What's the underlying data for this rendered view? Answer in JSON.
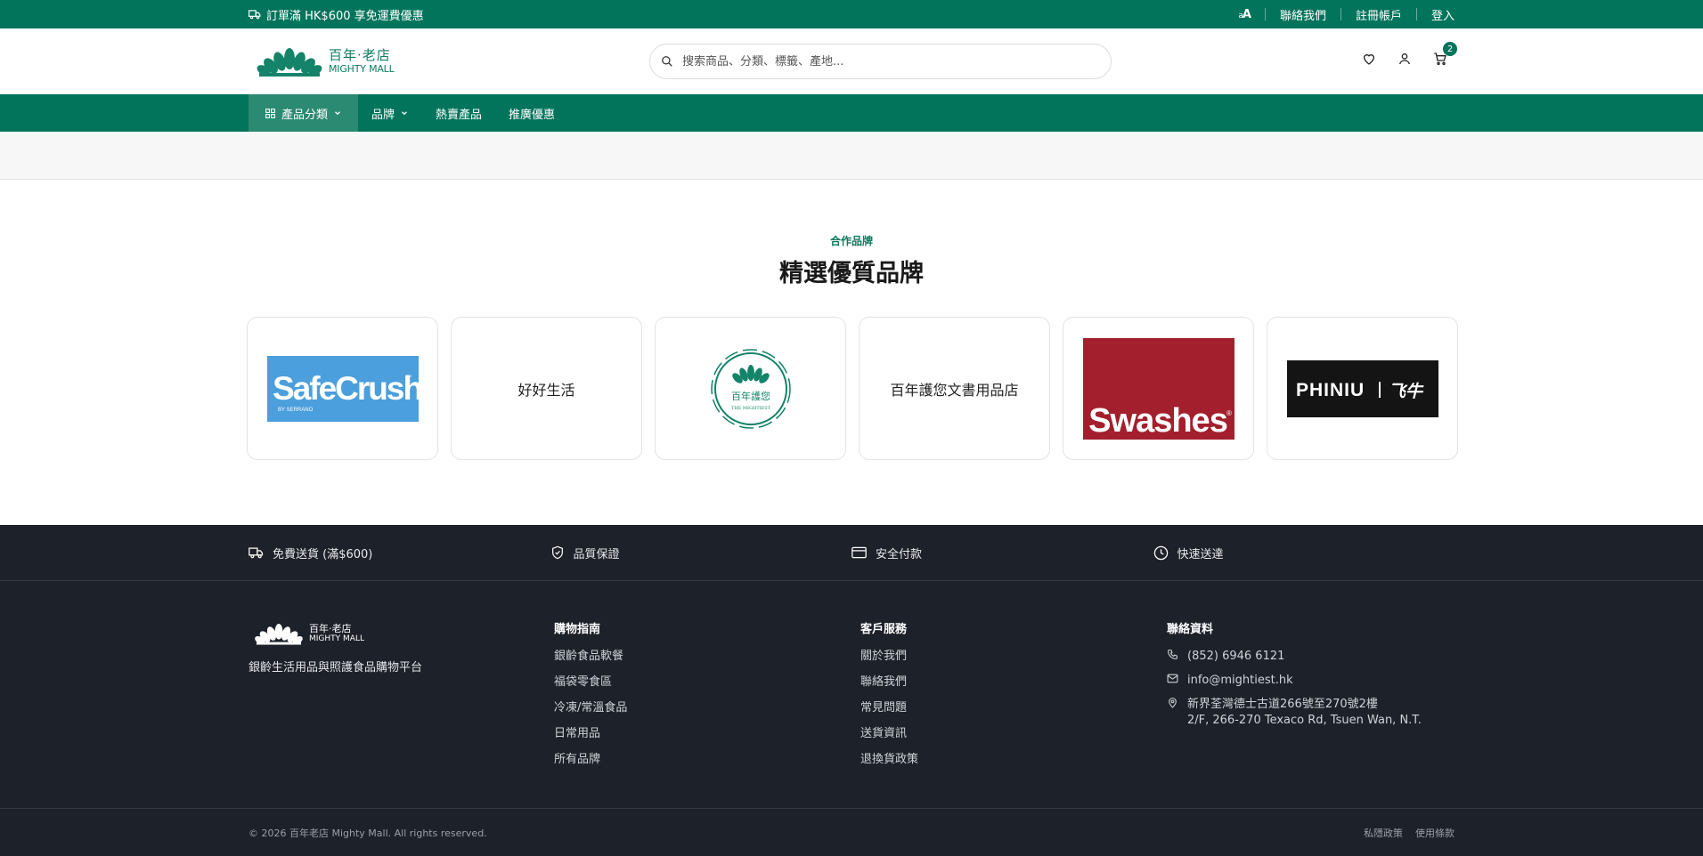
{
  "topbar": {
    "promo": "訂單滿 HK$600 享免運費優惠",
    "font_size_small": "a",
    "font_size_large": "A",
    "contact": "聯絡我們",
    "register": "註冊帳戶",
    "login": "登入"
  },
  "header": {
    "logo_cn": "百年·老店",
    "logo_en": "MIGHTY MALL",
    "search_placeholder": "搜索商品、分類、標籤、產地...",
    "cart_count": "2",
    "icons": [
      "heart-icon",
      "user-icon",
      "cart-icon"
    ]
  },
  "nav": {
    "items": [
      {
        "label": "產品分類"
      },
      {
        "label": "品牌"
      },
      {
        "label": "熱賣產品"
      },
      {
        "label": "推廣優惠"
      }
    ]
  },
  "brands": {
    "eyebrow": "合作品牌",
    "title": "精選優質品牌",
    "cards": [
      {
        "type": "logo",
        "name": "SafeCrush",
        "sub": "BY SERRANO",
        "tm": "™"
      },
      {
        "type": "text",
        "name": "好好生活"
      },
      {
        "type": "logo",
        "name": "百年護您",
        "sub": "THE MIGHTIEST"
      },
      {
        "type": "text",
        "name": "百年護您文書用品店"
      },
      {
        "type": "logo",
        "name": "Swashes",
        "tm": "®"
      },
      {
        "type": "logo",
        "name": "PHINIU",
        "sub": "飞牛"
      }
    ]
  },
  "footer": {
    "features": [
      {
        "label": "免費送貨 (滿$600)",
        "icon": "truck-icon"
      },
      {
        "label": "品質保證",
        "icon": "shield-icon"
      },
      {
        "label": "安全付款",
        "icon": "card-icon"
      },
      {
        "label": "快速送達",
        "icon": "clock-icon"
      }
    ],
    "logo_cn": "百年·老店",
    "logo_en": "MIGHTY MALL",
    "tagline": "銀齡生活用品與照護食品購物平台",
    "guide": {
      "heading": "購物指南",
      "links": [
        "銀齡食品軟餐",
        "福袋零食區",
        "冷凍/常溫食品",
        "日常用品",
        "所有品牌"
      ]
    },
    "service": {
      "heading": "客戶服務",
      "links": [
        "關於我們",
        "聯絡我們",
        "常見問題",
        "送貨資訊",
        "退換貨政策"
      ]
    },
    "contact": {
      "heading": "聯絡資料",
      "phone": "(852) 6946 6121",
      "email": "info@mightiest.hk",
      "address_cn": "新界荃灣德士古道266號至270號2樓",
      "address_en": "2/F, 266-270 Texaco Rd, Tsuen Wan, N.T."
    },
    "copyright": "© 2026 百年老店 Mighty Mall. All rights reserved.",
    "privacy": "私隱政策",
    "terms": "使用條款"
  },
  "colors": {
    "brand_green": "#03745c",
    "footer_bg": "#1d2129",
    "swashes_red": "#a31f2d",
    "safecrush_blue": "#4a9fdc"
  }
}
